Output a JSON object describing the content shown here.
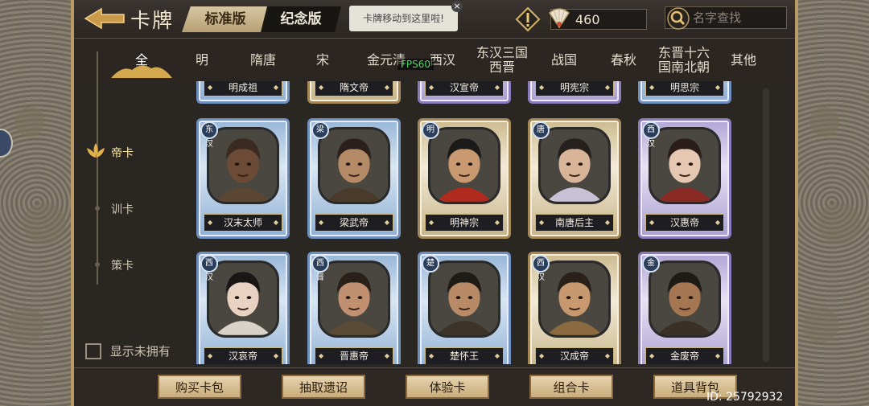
{
  "header": {
    "title": "卡牌",
    "version_tabs": [
      "标准版",
      "纪念版"
    ],
    "active_version": "标准版",
    "tooltip": "卡牌移动到这里啦!",
    "currency_amount": "460",
    "search_placeholder": "名字查找"
  },
  "dynasty_tabs": [
    {
      "label": "全",
      "active": true
    },
    {
      "label": "明"
    },
    {
      "label": "隋唐"
    },
    {
      "label": "宋"
    },
    {
      "label": "金元清"
    },
    {
      "label": "西汉"
    },
    {
      "label": "东汉三国\n西晋"
    },
    {
      "label": "战国"
    },
    {
      "label": "春秋"
    },
    {
      "label": "东晋十六\n国南北朝"
    },
    {
      "label": "其他"
    }
  ],
  "fps": "FPS60",
  "categories": [
    {
      "label": "帝卡",
      "active": true
    },
    {
      "label": "训卡"
    },
    {
      "label": "策卡"
    }
  ],
  "show_unowned": "显示未拥有",
  "cards_partial_row": [
    "明成祖",
    "隋文帝",
    "汉宣帝",
    "明宪宗",
    "明思宗"
  ],
  "cards": [
    {
      "name": "汉末太师",
      "badge": "东汉",
      "frame": "blue",
      "skin": "#6b4a36",
      "hair": "#3a2a20",
      "clothes": "#5a4632"
    },
    {
      "name": "梁武帝",
      "badge": "梁",
      "frame": "blue",
      "skin": "#b58a66",
      "hair": "#2a1f1a",
      "clothes": "#4a3a2a"
    },
    {
      "name": "明神宗",
      "badge": "明",
      "frame": "gold",
      "skin": "#c99a72",
      "hair": "#1c1a18",
      "clothes": "#b12a1e"
    },
    {
      "name": "南唐后主",
      "badge": "唐",
      "frame": "gold",
      "skin": "#d8b498",
      "hair": "#25201c",
      "clothes": "#c9c2d6"
    },
    {
      "name": "汉惠帝",
      "badge": "西汉",
      "frame": "purple",
      "skin": "#e6c8b2",
      "hair": "#2a1c18",
      "clothes": "#8a2a24"
    },
    {
      "name": "汉哀帝",
      "badge": "西汉",
      "frame": "blue",
      "skin": "#ead2c2",
      "hair": "#1a1616",
      "clothes": "#d8d2ca"
    },
    {
      "name": "晋惠帝",
      "badge": "西晋",
      "frame": "blue",
      "skin": "#c09070",
      "hair": "#2a201a",
      "clothes": "#5a4a36"
    },
    {
      "name": "楚怀王",
      "badge": "楚",
      "frame": "blue",
      "skin": "#b88a66",
      "hair": "#1e1a16",
      "clothes": "#3c3428"
    },
    {
      "name": "汉成帝",
      "badge": "西汉",
      "frame": "gold",
      "skin": "#c8986e",
      "hair": "#2a201a",
      "clothes": "#8a6a3e"
    },
    {
      "name": "金废帝",
      "badge": "金",
      "frame": "purple",
      "skin": "#a47652",
      "hair": "#1e1a16",
      "clothes": "#3a3026"
    }
  ],
  "bottom_buttons": [
    "购买卡包",
    "抽取遗诏",
    "体验卡",
    "组合卡",
    "道具背包"
  ],
  "user_id": "ID: 25792932",
  "colors": {
    "accent_gold": "#c9ad7c",
    "frame_blue": "#6f8fbf",
    "fps_green": "#49d868"
  }
}
